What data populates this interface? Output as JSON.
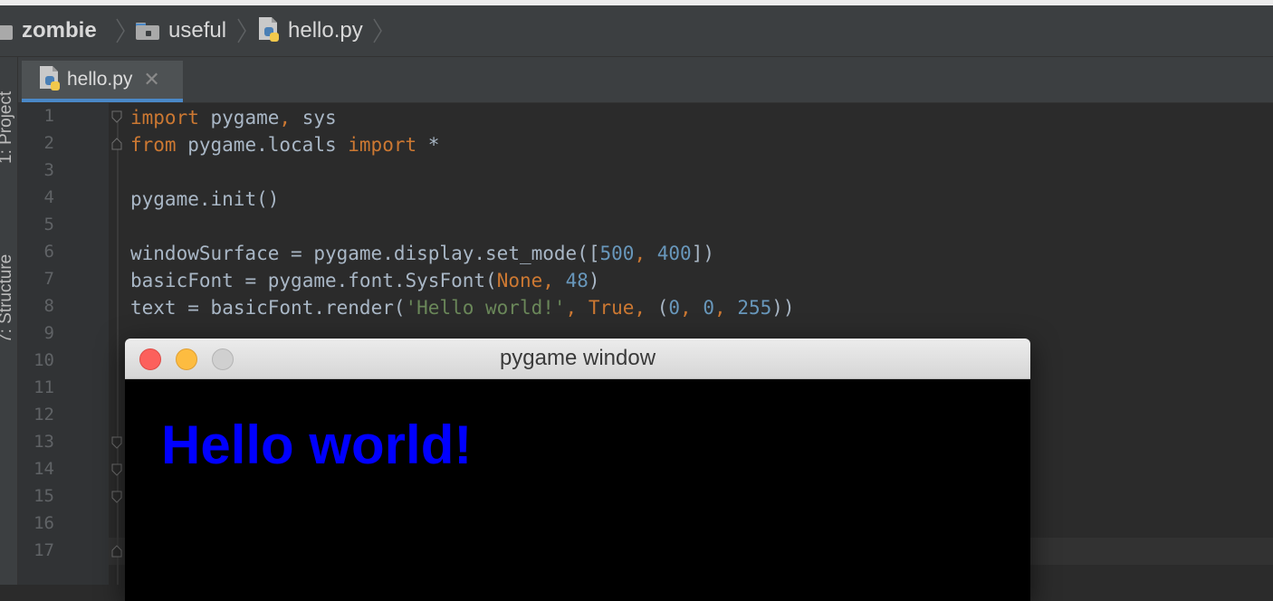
{
  "breadcrumb": {
    "items": [
      {
        "label": "zombie",
        "icon": "folder-icon"
      },
      {
        "label": "useful",
        "icon": "folder-icon"
      },
      {
        "label": "hello.py",
        "icon": "python-file-icon"
      }
    ]
  },
  "tool_strip": {
    "project_label": "1: Project",
    "structure_label": "7: Structure"
  },
  "tabs": [
    {
      "label": "hello.py",
      "close": "✕",
      "icon": "python-file-icon"
    }
  ],
  "editor": {
    "line_numbers": [
      "1",
      "2",
      "3",
      "4",
      "5",
      "6",
      "7",
      "8",
      "9",
      "10",
      "11",
      "12",
      "13",
      "14",
      "15",
      "16",
      "17"
    ],
    "lines": [
      "import pygame, sys",
      "from pygame.locals import *",
      "",
      "pygame.init()",
      "",
      "windowSurface = pygame.display.set_mode([500, 400])",
      "basicFont = pygame.font.SysFont(None, 48)",
      "text = basicFont.render('Hello world!', True, (0, 0, 255))"
    ]
  },
  "pygame_window": {
    "title": "pygame window",
    "text": "Hello world!",
    "text_color": "#0000ff",
    "background": "#000000"
  },
  "colors": {
    "keyword": "#cc7832",
    "number": "#6897bb",
    "string": "#6a8759",
    "identifier": "#a9b7c6",
    "close_button": "#fc605c",
    "minimize_button": "#fdbc40",
    "zoom_button": "#d0d0d0"
  }
}
